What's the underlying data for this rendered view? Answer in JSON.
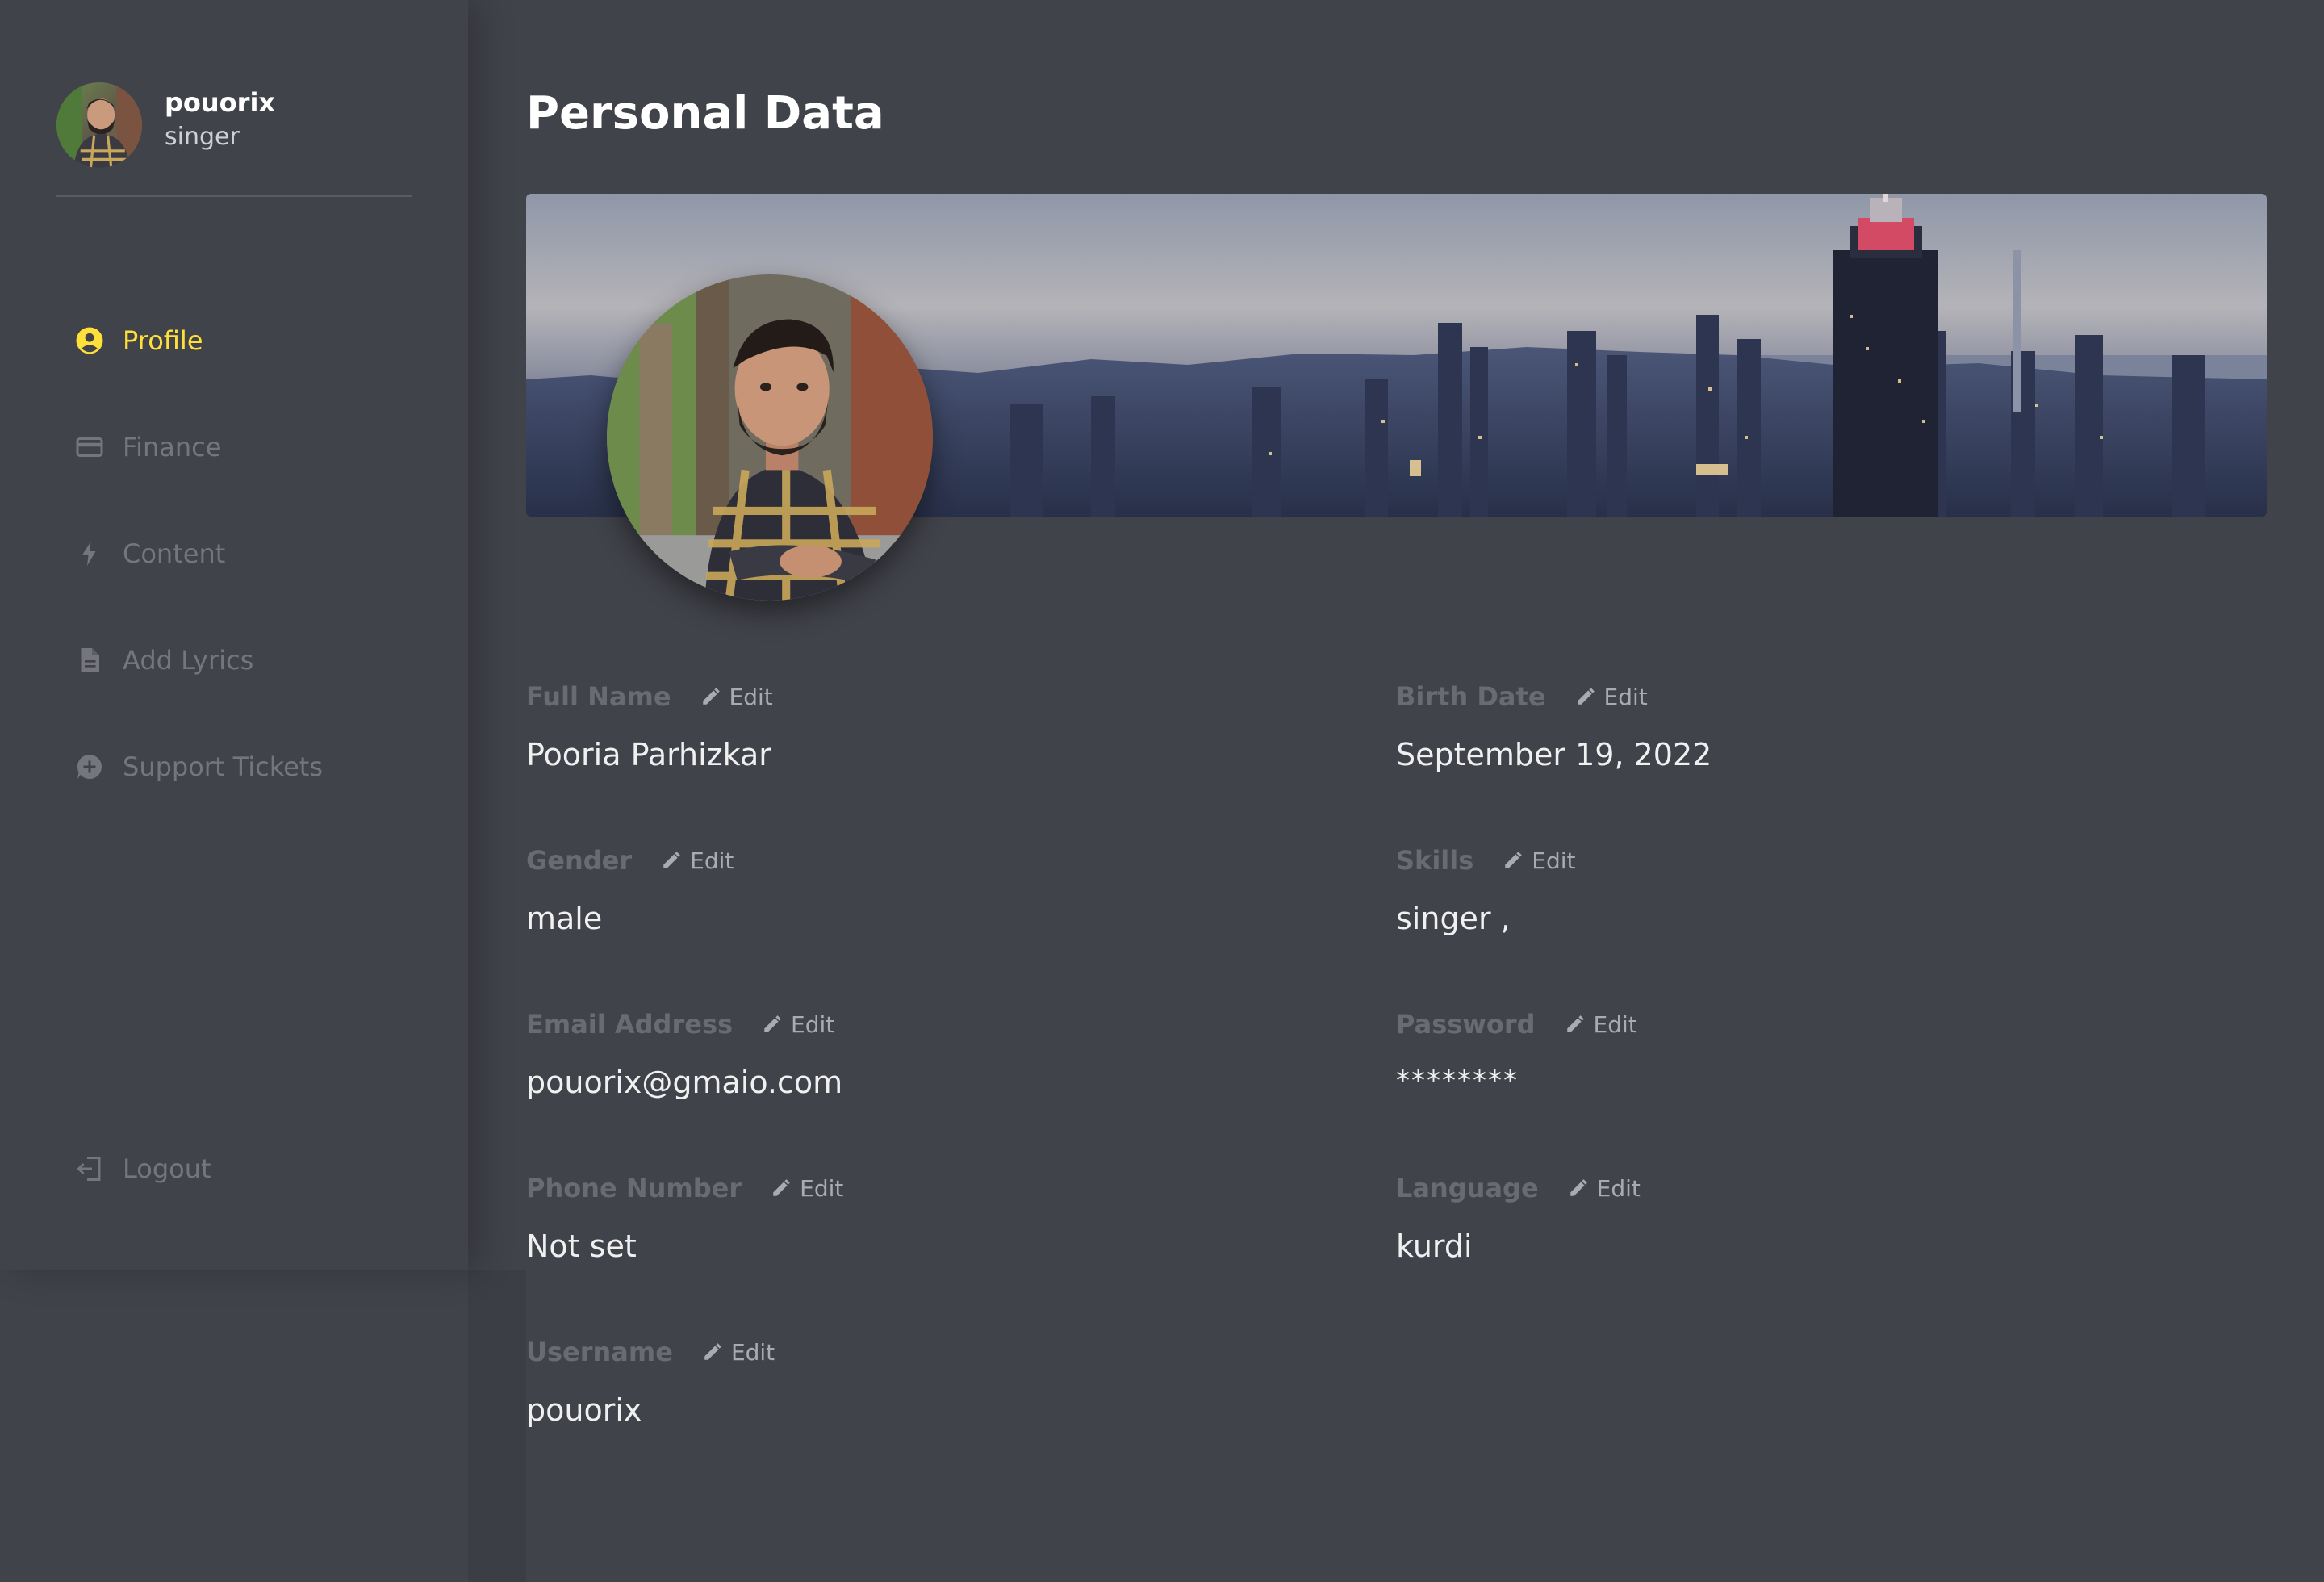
{
  "user": {
    "name": "pouorix",
    "role": "singer"
  },
  "sidebar": {
    "items": [
      {
        "label": "Profile",
        "icon": "user-circle-icon",
        "active": true
      },
      {
        "label": "Finance",
        "icon": "credit-card-icon",
        "active": false
      },
      {
        "label": "Content",
        "icon": "bolt-icon",
        "active": false
      },
      {
        "label": "Add Lyrics",
        "icon": "document-icon",
        "active": false
      },
      {
        "label": "Support Tickets",
        "icon": "chat-plus-icon",
        "active": false
      }
    ],
    "logout": {
      "label": "Logout",
      "icon": "logout-icon"
    }
  },
  "main": {
    "title": "Personal Data",
    "edit_label": "Edit",
    "fields": {
      "full_name": {
        "label": "Full Name",
        "value": "Pooria Parhizkar"
      },
      "birth_date": {
        "label": "Birth Date",
        "value": "September 19, 2022"
      },
      "gender": {
        "label": "Gender",
        "value": "male"
      },
      "skills": {
        "label": "Skills",
        "value": "singer ,"
      },
      "email": {
        "label": "Email Address",
        "value": "pouorix@gmaio.com"
      },
      "password": {
        "label": "Password",
        "value": "********"
      },
      "phone": {
        "label": "Phone Number",
        "value": "Not set"
      },
      "language": {
        "label": "Language",
        "value": "kurdi"
      },
      "username": {
        "label": "Username",
        "value": "pouorix"
      }
    }
  },
  "colors": {
    "background": "#41434a",
    "accent": "#ffdf3a",
    "muted": "#74767c",
    "label": "#696b72"
  }
}
